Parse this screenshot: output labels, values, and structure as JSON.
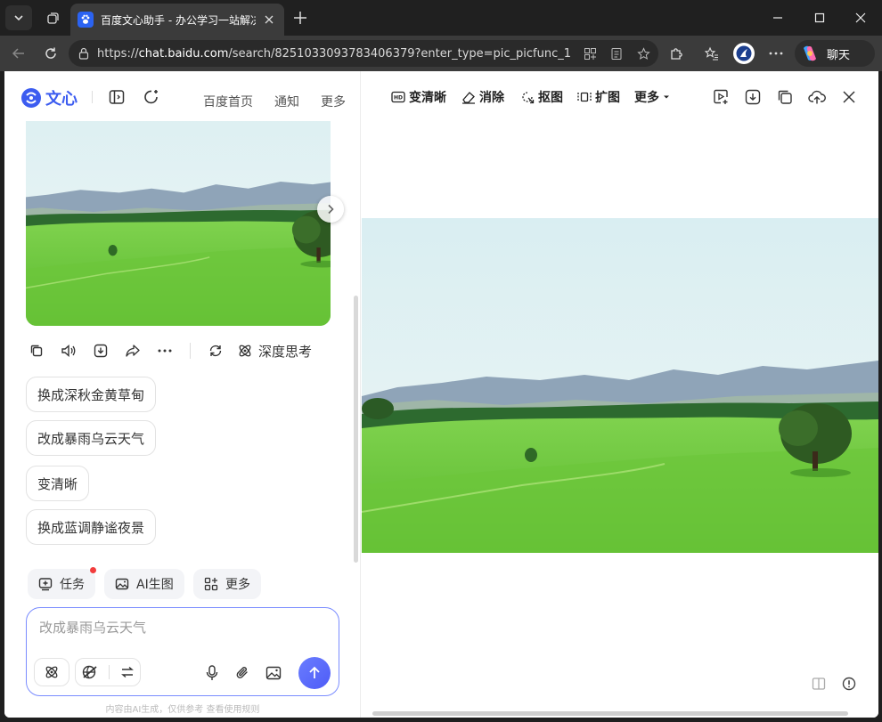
{
  "browser": {
    "tab_title": "百度文心助手 - 办公学习一站解决",
    "url_prefix": "https://",
    "url_domain": "chat.baidu.com",
    "url_path": "/search/825103309378340637​9?enter_type=pic_picfunc_1",
    "copilot_label": "聊天"
  },
  "header": {
    "logo_text": "文心",
    "links": [
      "百度首页",
      "通知",
      "更多"
    ]
  },
  "actions": {
    "deep_think": "深度思考"
  },
  "suggestions": [
    "换成深秋金黄草甸",
    "改成暴雨乌云天气",
    "变清晰",
    "换成蓝调静谧夜景"
  ],
  "tools": [
    "任务",
    "AI生图",
    "更多"
  ],
  "input": {
    "placeholder": "改成暴雨乌云天气"
  },
  "footnote": "内容由AI生成，仅供参考   查看使用规则",
  "viewer_toolbar": {
    "clear": "变清晰",
    "erase": "消除",
    "cutout": "抠图",
    "expand": "扩图",
    "more": "更多"
  },
  "colors": {
    "brand": "#3c5cf0",
    "send_button": "#5b6cf9",
    "badge": "#f23d3d"
  }
}
